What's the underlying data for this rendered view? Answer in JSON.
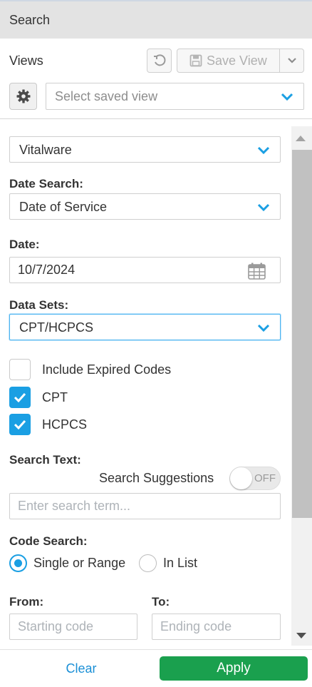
{
  "header": {
    "title": "Search"
  },
  "views": {
    "label": "Views",
    "save_view_label": "Save View",
    "saved_view_placeholder": "Select saved view"
  },
  "form": {
    "source": {
      "value": "Vitalware"
    },
    "date_search": {
      "label": "Date Search:",
      "value": "Date of Service"
    },
    "date": {
      "label": "Date:",
      "value": "10/7/2024"
    },
    "data_sets": {
      "label": "Data Sets:",
      "value": "CPT/HCPCS"
    },
    "checkboxes": [
      {
        "label": "Include Expired Codes",
        "checked": false
      },
      {
        "label": "CPT",
        "checked": true
      },
      {
        "label": "HCPCS",
        "checked": true
      }
    ],
    "search_text": {
      "label": "Search Text:",
      "suggestions_label": "Search Suggestions",
      "toggle_state": "OFF",
      "placeholder": "Enter search term..."
    },
    "code_search": {
      "label": "Code Search:",
      "options": [
        {
          "label": "Single or Range",
          "selected": true
        },
        {
          "label": "In List",
          "selected": false
        }
      ]
    },
    "from": {
      "label": "From:",
      "placeholder": "Starting code"
    },
    "to": {
      "label": "To:",
      "placeholder": "Ending code"
    }
  },
  "footer": {
    "clear_label": "Clear",
    "apply_label": "Apply"
  },
  "colors": {
    "accent": "#1a9fe3",
    "apply": "#1aa04e",
    "link": "#1a8fd6"
  }
}
